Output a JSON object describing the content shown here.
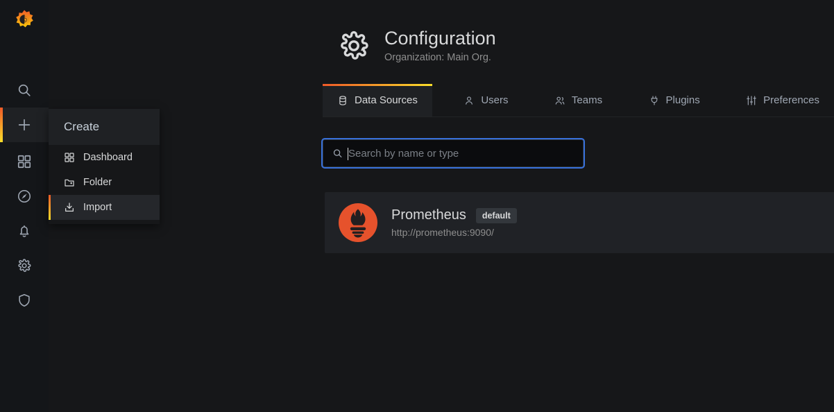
{
  "brand": {
    "logo_icon": "grafana-logo"
  },
  "sidebar": {
    "items": [
      {
        "icon": "search-icon",
        "name": "search",
        "active": false
      },
      {
        "icon": "plus-icon",
        "name": "create",
        "active": true
      },
      {
        "icon": "dashboards-icon",
        "name": "dashboards",
        "active": false
      },
      {
        "icon": "compass-icon",
        "name": "explore",
        "active": false
      },
      {
        "icon": "bell-icon",
        "name": "alerting",
        "active": false
      },
      {
        "icon": "gear-icon",
        "name": "configuration",
        "active": false
      },
      {
        "icon": "shield-icon",
        "name": "server-admin",
        "active": false
      }
    ]
  },
  "dropdown": {
    "header": "Create",
    "items": [
      {
        "label": "Dashboard",
        "icon": "dashboard-icon",
        "active": false
      },
      {
        "label": "Folder",
        "icon": "folder-plus-icon",
        "active": false
      },
      {
        "label": "Import",
        "icon": "import-download-icon",
        "active": true
      }
    ]
  },
  "header": {
    "icon": "gear-icon",
    "title": "Configuration",
    "subtitle": "Organization: Main Org."
  },
  "tabs": [
    {
      "label": "Data Sources",
      "icon": "database-icon",
      "active": true
    },
    {
      "label": "Users",
      "icon": "user-icon",
      "active": false
    },
    {
      "label": "Teams",
      "icon": "users-icon",
      "active": false
    },
    {
      "label": "Plugins",
      "icon": "plug-icon",
      "active": false
    },
    {
      "label": "Preferences",
      "icon": "sliders-icon",
      "active": false
    }
  ],
  "search": {
    "placeholder": "Search by name or type",
    "value": "",
    "icon": "search-icon"
  },
  "datasources": [
    {
      "name": "Prometheus",
      "badge": "default",
      "url": "http://prometheus:9090/",
      "logo": "prometheus-logo"
    }
  ],
  "colors": {
    "accent_start": "#f05a28",
    "accent_end": "#fade2a",
    "focus_ring": "#3871dc",
    "prometheus_orange": "#e6522c",
    "page_bg": "#161719",
    "panel_bg": "#202226"
  }
}
